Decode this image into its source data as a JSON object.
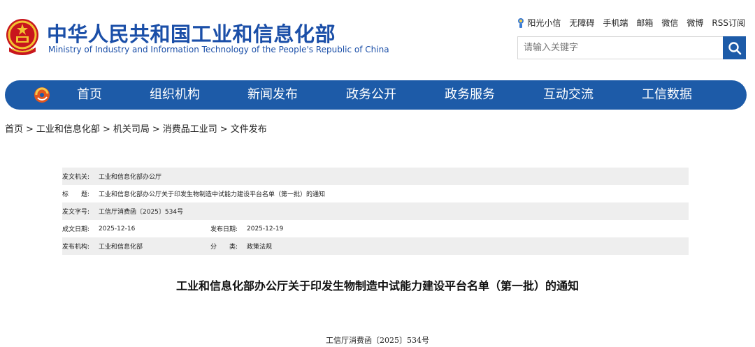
{
  "header": {
    "title_cn": "中华人民共和国工业和信息化部",
    "title_en": "Ministry of Industry and Information Technology of the People's Republic of China",
    "emblem_icon": "national-emblem-icon",
    "top_links": [
      "阳光小信",
      "无障碍",
      "手机端",
      "邮箱",
      "微信",
      "微博",
      "RSS订阅"
    ],
    "search_placeholder": "请输入关键字",
    "search_icon": "search-icon"
  },
  "nav": {
    "logo_icon": "miit-logo-icon",
    "items": [
      "首页",
      "组织机构",
      "新闻发布",
      "政务公开",
      "政务服务",
      "互动交流",
      "工信数据"
    ],
    "color": "#1d5ba8"
  },
  "breadcrumb": [
    "首页",
    "工业和信息化部",
    "机关司局",
    "消费品工业司",
    "文件发布"
  ],
  "meta": {
    "issuer_label": "发文机关:",
    "issuer": "工业和信息化部办公厅",
    "title_label": "标　　题:",
    "title": "工业和信息化部办公厅关于印发生物制造中试能力建设平台名单（第一批）的通知",
    "doc_no_label": "发文字号:",
    "doc_no": "工信厅消费函〔2025〕534号",
    "created_label": "成文日期:",
    "created": "2025-12-16",
    "published_label": "发布日期:",
    "published": "2025-12-19",
    "org_label": "发布机构:",
    "org": "工业和信息化部",
    "category_label": "分　　类:",
    "category": "政策法规"
  },
  "document": {
    "title": "工业和信息化部办公厅关于印发生物制造中试能力建设平台名单（第一批）的通知",
    "number": "工信厅消费函〔2025〕534号"
  }
}
